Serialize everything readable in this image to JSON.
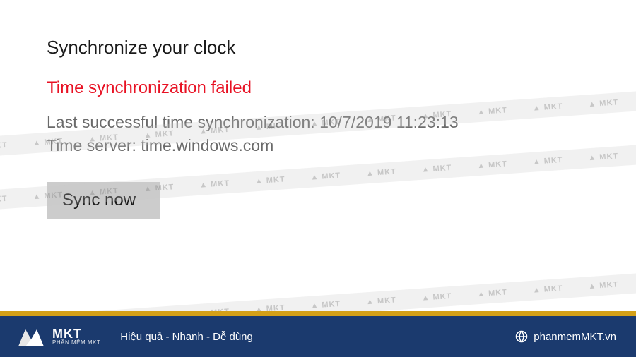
{
  "heading": "Synchronize your clock",
  "error_message": "Time synchronization failed",
  "last_sync_label": "Last successful time synchronization:",
  "last_sync_value": "10/7/2019 11:23:13",
  "time_server_label": "Time server:",
  "time_server_value": "time.windows.com",
  "button_label": "Sync now",
  "watermark_text": "MKT",
  "footer": {
    "logo_main": "MKT",
    "logo_sub": "PHẦN MỀM MKT",
    "tagline": "Hiệu quả - Nhanh - Dễ dùng",
    "url": "phanmemMKT.vn"
  },
  "colors": {
    "error": "#e81123",
    "footer_bg": "#1b3a6e",
    "accent": "#d4a017"
  }
}
